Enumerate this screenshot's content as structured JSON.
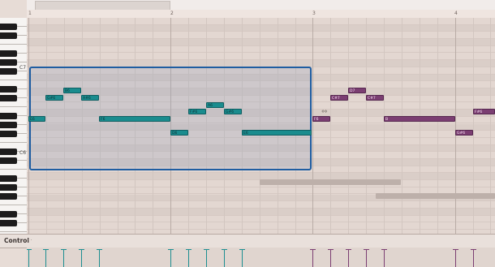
{
  "ruler": {
    "ticks": [
      "1",
      "2",
      "3",
      "4"
    ]
  },
  "piano": {
    "labels": [
      "C7",
      "C6"
    ]
  },
  "control": {
    "label": "Control",
    "dropdown_hint": "· ·"
  },
  "notes": [
    {
      "label": "E6",
      "color": "teal"
    },
    {
      "label": "G#6",
      "color": "teal"
    },
    {
      "label": "B6",
      "color": "teal"
    },
    {
      "label": "A#6",
      "color": "teal"
    },
    {
      "label": "F6",
      "color": "teal"
    },
    {
      "label": "D6",
      "color": "teal"
    },
    {
      "label": "F#6",
      "color": "teal"
    },
    {
      "label": "A6",
      "color": "teal"
    },
    {
      "label": "G#6",
      "color": "teal"
    },
    {
      "label": "E6",
      "color": "teal"
    },
    {
      "label": "F6",
      "color": "purple"
    },
    {
      "label": "C#7",
      "color": "purple"
    },
    {
      "label": "D7",
      "color": "purple"
    },
    {
      "label": "C#7",
      "color": "purple"
    },
    {
      "label": "B",
      "color": "purple"
    },
    {
      "label": "G#6",
      "color": "purple"
    },
    {
      "label": "F#6",
      "color": "purple"
    }
  ],
  "colors": {
    "teal": "#1a8c8e",
    "purple": "#7b3e72",
    "selection": "#1f5da1",
    "background": "#e3d7d1"
  }
}
